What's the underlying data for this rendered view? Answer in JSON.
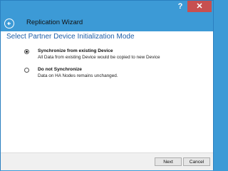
{
  "window": {
    "help_label": "?",
    "close_label": "✕"
  },
  "header": {
    "title": "Replication Wizard"
  },
  "page": {
    "title": "Select Partner Device Initialization Mode",
    "options": [
      {
        "label": "Synchronize from existing Device",
        "description": "All Data from existing Device would be copied to new Device",
        "selected": true
      },
      {
        "label": "Do not Synchronize",
        "description": "Data on HA Nodes remains unchanged.",
        "selected": false
      }
    ]
  },
  "footer": {
    "next_label": "Next",
    "cancel_label": "Cancel"
  },
  "colors": {
    "accent": "#3c9ad6",
    "title_blue": "#1f5fa8",
    "close_red": "#c75050"
  },
  "icons": {
    "back": "back-arrow-icon"
  }
}
